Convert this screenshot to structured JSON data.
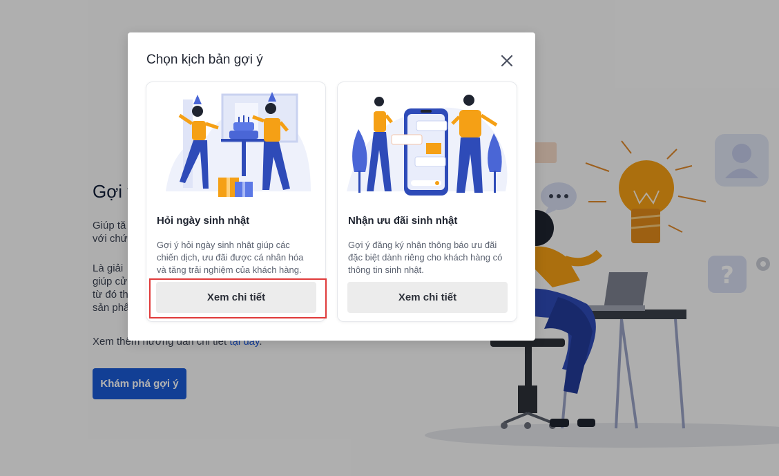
{
  "background": {
    "heading": "Gợi ý",
    "paragraph1": [
      "Giúp tă",
      "với chứ"
    ],
    "paragraph2": [
      "Là giải",
      "giúp cử",
      "từ đó th",
      "sản phẩ"
    ],
    "guide_text": "Xem thêm hướng dẫn chi tiết",
    "guide_link": "tại đây",
    "guide_period": ".",
    "explore_button": "Khám phá gợi ý"
  },
  "modal": {
    "title": "Chọn kịch bản gợi ý",
    "cards": [
      {
        "title": "Hỏi ngày sinh nhật",
        "description_lines": [
          "Gợi ý hỏi ngày sinh nhật giúp các",
          "chiến dịch, ưu đãi được cá nhân hóa",
          "và tăng trải nghiệm của khách hàng."
        ],
        "button": "Xem chi tiết"
      },
      {
        "title": "Nhận ưu đãi sinh nhật",
        "description_lines": [
          "Gợi ý đăng ký nhận thông báo ưu đãi",
          "đặc biệt dành riêng cho khách hàng có",
          "thông tin sinh nhật."
        ],
        "button": "Xem chi tiết"
      }
    ]
  },
  "colors": {
    "primary": "#1a5bd6",
    "illustration_orange": "#f5a015",
    "illustration_blue": "#2e4bb8",
    "highlight_red": "#e03a3a"
  },
  "icons": [
    "close-icon",
    "lightbulb-icon",
    "chat-bubble-icon",
    "user-icon",
    "question-icon",
    "gear-icon"
  ]
}
